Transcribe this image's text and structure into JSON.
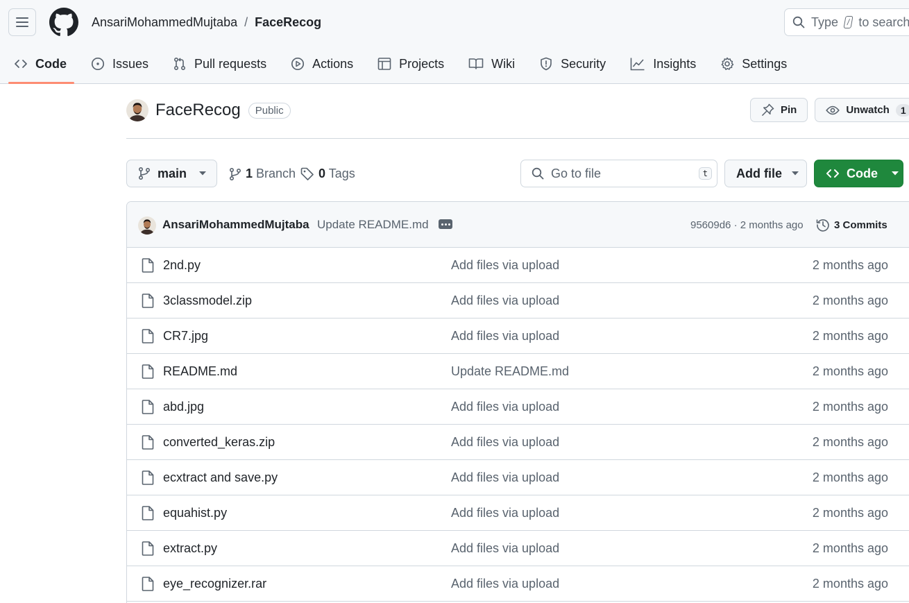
{
  "header": {
    "owner": "AnsariMohammedMujtaba",
    "separator": "/",
    "repo": "FaceRecog",
    "search_prefix": "Type",
    "search_key": "/",
    "search_suffix": "to search"
  },
  "tabs": [
    {
      "label": "Code",
      "icon": "code-icon",
      "active": true
    },
    {
      "label": "Issues",
      "icon": "issue-icon"
    },
    {
      "label": "Pull requests",
      "icon": "pull-request-icon"
    },
    {
      "label": "Actions",
      "icon": "play-icon"
    },
    {
      "label": "Projects",
      "icon": "table-icon"
    },
    {
      "label": "Wiki",
      "icon": "book-icon"
    },
    {
      "label": "Security",
      "icon": "shield-icon"
    },
    {
      "label": "Insights",
      "icon": "graph-icon"
    },
    {
      "label": "Settings",
      "icon": "gear-icon"
    }
  ],
  "repo_head": {
    "title": "FaceRecog",
    "visibility": "Public",
    "pin_label": "Pin",
    "watch_label": "Unwatch",
    "watch_count": "1"
  },
  "file_nav": {
    "branch": "main",
    "branch_count": "1",
    "branch_label": "Branch",
    "tag_count": "0",
    "tag_label": "Tags",
    "goto_placeholder": "Go to file",
    "goto_shortcut": "t",
    "add_file_label": "Add file",
    "code_label": "Code"
  },
  "latest_commit": {
    "author": "AnsariMohammedMujtaba",
    "message": "Update README.md",
    "hash_time": "95609d6 · 2 months ago",
    "commits_label": "3 Commits"
  },
  "files": [
    {
      "name": "2nd.py",
      "message": "Add files via upload",
      "date": "2 months ago"
    },
    {
      "name": "3classmodel.zip",
      "message": "Add files via upload",
      "date": "2 months ago"
    },
    {
      "name": "CR7.jpg",
      "message": "Add files via upload",
      "date": "2 months ago"
    },
    {
      "name": "README.md",
      "message": "Update README.md",
      "date": "2 months ago"
    },
    {
      "name": "abd.jpg",
      "message": "Add files via upload",
      "date": "2 months ago"
    },
    {
      "name": "converted_keras.zip",
      "message": "Add files via upload",
      "date": "2 months ago"
    },
    {
      "name": "ecxtract and save.py",
      "message": "Add files via upload",
      "date": "2 months ago"
    },
    {
      "name": "equahist.py",
      "message": "Add files via upload",
      "date": "2 months ago"
    },
    {
      "name": "extract.py",
      "message": "Add files via upload",
      "date": "2 months ago"
    },
    {
      "name": "eye_recognizer.rar",
      "message": "Add files via upload",
      "date": "2 months ago"
    }
  ],
  "colors": {
    "accent_underline": "#fd8c73",
    "code_button": "#1f883d",
    "muted_text": "#59636e",
    "border": "#d0d7de"
  }
}
